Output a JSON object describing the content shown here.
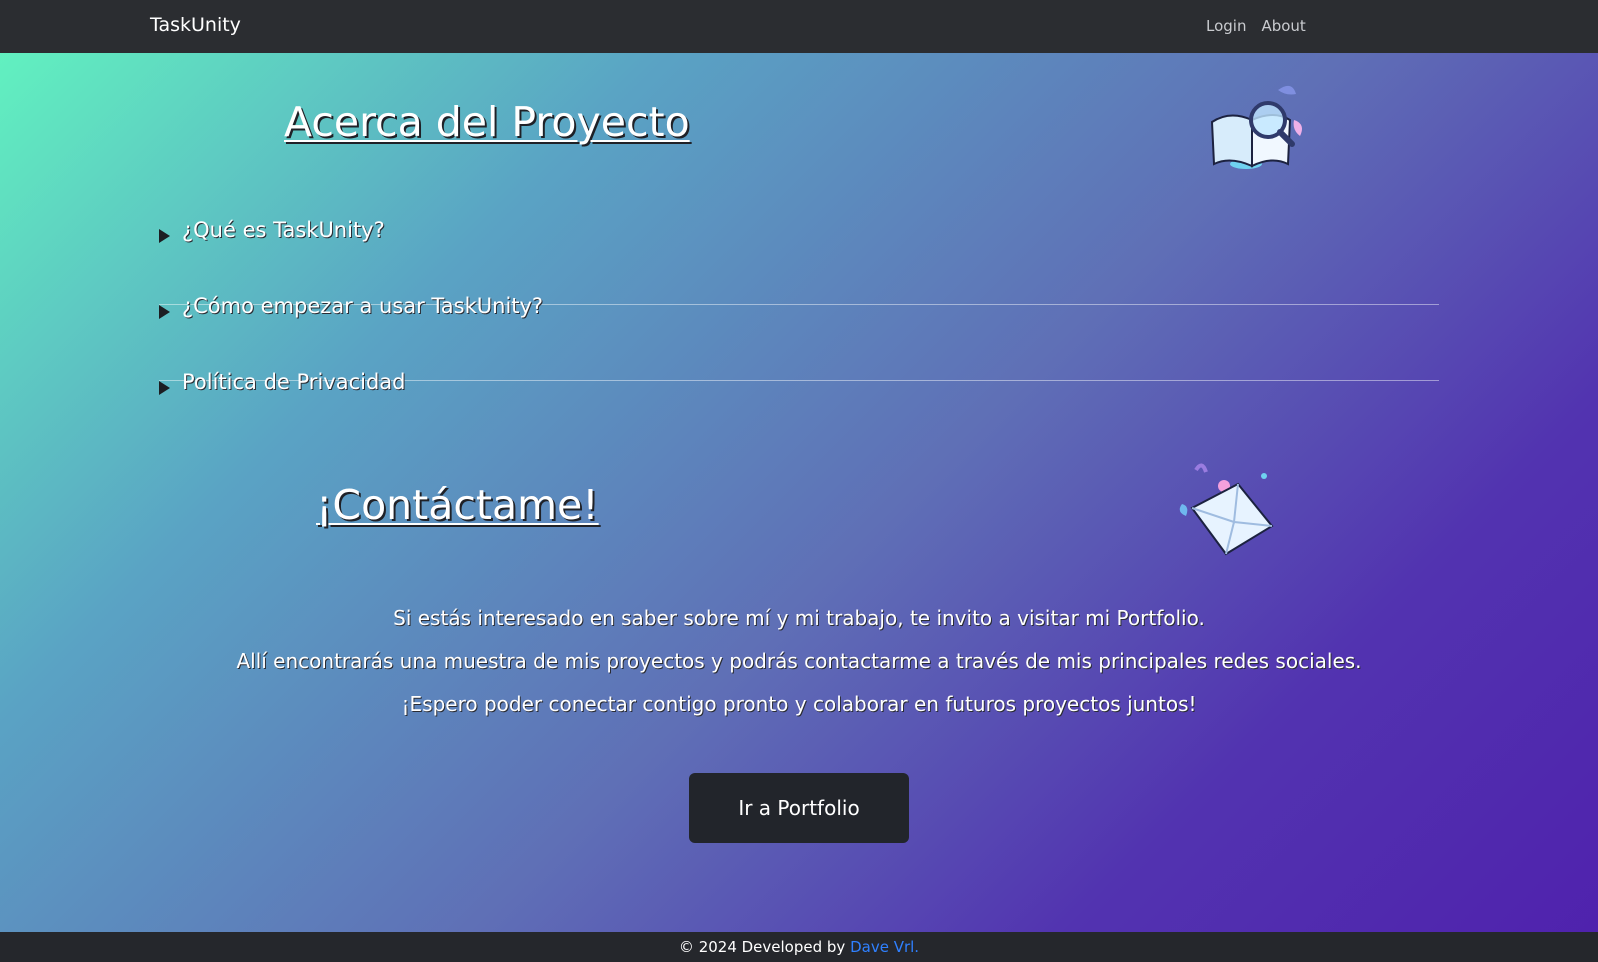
{
  "navbar": {
    "brand": "TaskUnity",
    "links": [
      "Login",
      "About"
    ]
  },
  "about": {
    "title": "Acerca del Proyecto",
    "faq": [
      "¿Qué es TaskUnity?",
      "¿Cómo empezar a usar TaskUnity?",
      "Política de Privacidad"
    ]
  },
  "contact": {
    "title": "¡Contáctame!",
    "paragraphs": [
      "Si estás interesado en saber sobre mí y mi trabajo, te invito a visitar mi Portfolio.",
      "Allí encontrarás una muestra de mis proyectos y podrás contactarme a través de mis principales redes sociales.",
      "¡Espero poder conectar contigo pronto y colaborar en futuros proyectos juntos!"
    ],
    "button_label": "Ir a Portfolio"
  },
  "footer": {
    "text": "© 2024 Developed by ",
    "link_text": "Dave Vrl."
  },
  "colors": {
    "gradient_start": "#62f7bf",
    "gradient_end": "#4f21ad",
    "navbar_bg": "#2b2d31",
    "button_bg": "#22252b",
    "footer_link": "#2f80ff"
  },
  "icons": [
    "book-magnifier-icon",
    "envelope-icon",
    "disclosure-triangle-icon"
  ]
}
